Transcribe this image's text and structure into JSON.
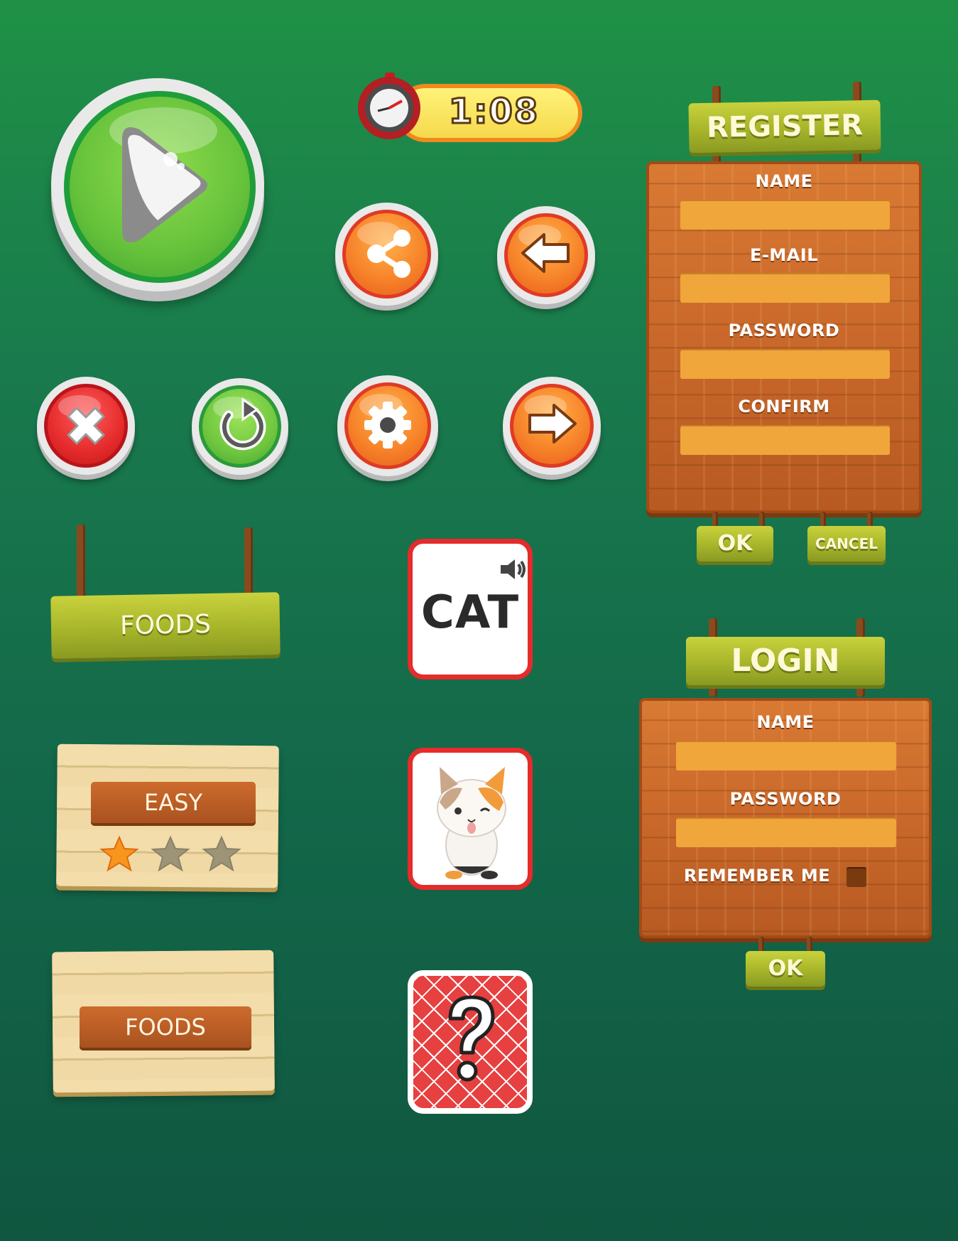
{
  "timer": {
    "value": "1:08"
  },
  "register": {
    "title": "REGISTER",
    "fields": [
      {
        "label": "NAME",
        "value": ""
      },
      {
        "label": "E-MAIL",
        "value": ""
      },
      {
        "label": "PASSWORD",
        "value": ""
      },
      {
        "label": "CONFIRM",
        "value": ""
      }
    ],
    "ok_label": "OK",
    "cancel_label": "CANCEL"
  },
  "login": {
    "title": "LOGIN",
    "fields": [
      {
        "label": "NAME",
        "value": ""
      },
      {
        "label": "PASSWORD",
        "value": ""
      }
    ],
    "remember_label": "REMEMBER ME",
    "remember_checked": false,
    "ok_label": "OK"
  },
  "hanging_sign": {
    "label": "FOODS"
  },
  "level_card": {
    "label": "EASY",
    "stars_earned": 1,
    "stars_total": 3
  },
  "category_card": {
    "label": "FOODS"
  },
  "word_card": {
    "word": "CAT",
    "sound_icon": "speaker-icon"
  },
  "image_card": {
    "icon": "cat-icon"
  },
  "hidden_card": {
    "icon": "question-mark-icon"
  },
  "buttons": {
    "play": "play-icon",
    "share": "share-icon",
    "back": "arrow-left-icon",
    "close": "close-icon",
    "restart": "restart-icon",
    "settings": "gear-icon",
    "next": "arrow-right-icon"
  },
  "colors": {
    "accent_orange": "#f7842a",
    "accent_red": "#e52b2b",
    "accent_green": "#6fc73f",
    "timer_yellow": "#fbe35e"
  }
}
